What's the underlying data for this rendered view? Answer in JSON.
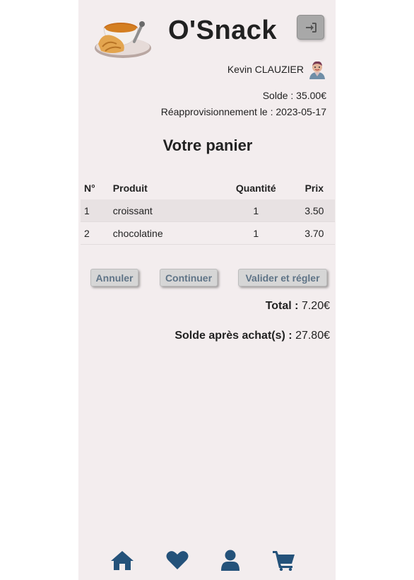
{
  "header": {
    "app_title": "O'Snack",
    "logo": "coffee-croissant-logo",
    "login_icon": "sign-in-icon"
  },
  "user": {
    "name": "Kevin CLAUZIER",
    "avatar_icon": "user-avatar-icon"
  },
  "account": {
    "balance_label": "Solde : 35.00€",
    "restock_label": "Réapprovisionnement le : 2023-05-17"
  },
  "cart": {
    "title": "Votre panier",
    "columns": [
      "N°",
      "Produit",
      "Quantité",
      "Prix"
    ],
    "rows": [
      {
        "num": "1",
        "product": "croissant",
        "qty": "1",
        "price": "3.50"
      },
      {
        "num": "2",
        "product": "chocolatine",
        "qty": "1",
        "price": "3.70"
      }
    ]
  },
  "actions": {
    "cancel": "Annuler",
    "continue": "Continuer",
    "validate": "Valider et régler"
  },
  "totals": {
    "total_label": "Total :",
    "total_value": "7.20€",
    "after_label": "Solde après achat(s) :",
    "after_value": "27.80€"
  },
  "bottom_nav": {
    "items": [
      "home-icon",
      "heart-icon",
      "user-icon",
      "cart-icon"
    ]
  },
  "colors": {
    "panel_bg": "#f3edee",
    "nav_icon": "#24527a",
    "button_text": "#5f7487"
  }
}
